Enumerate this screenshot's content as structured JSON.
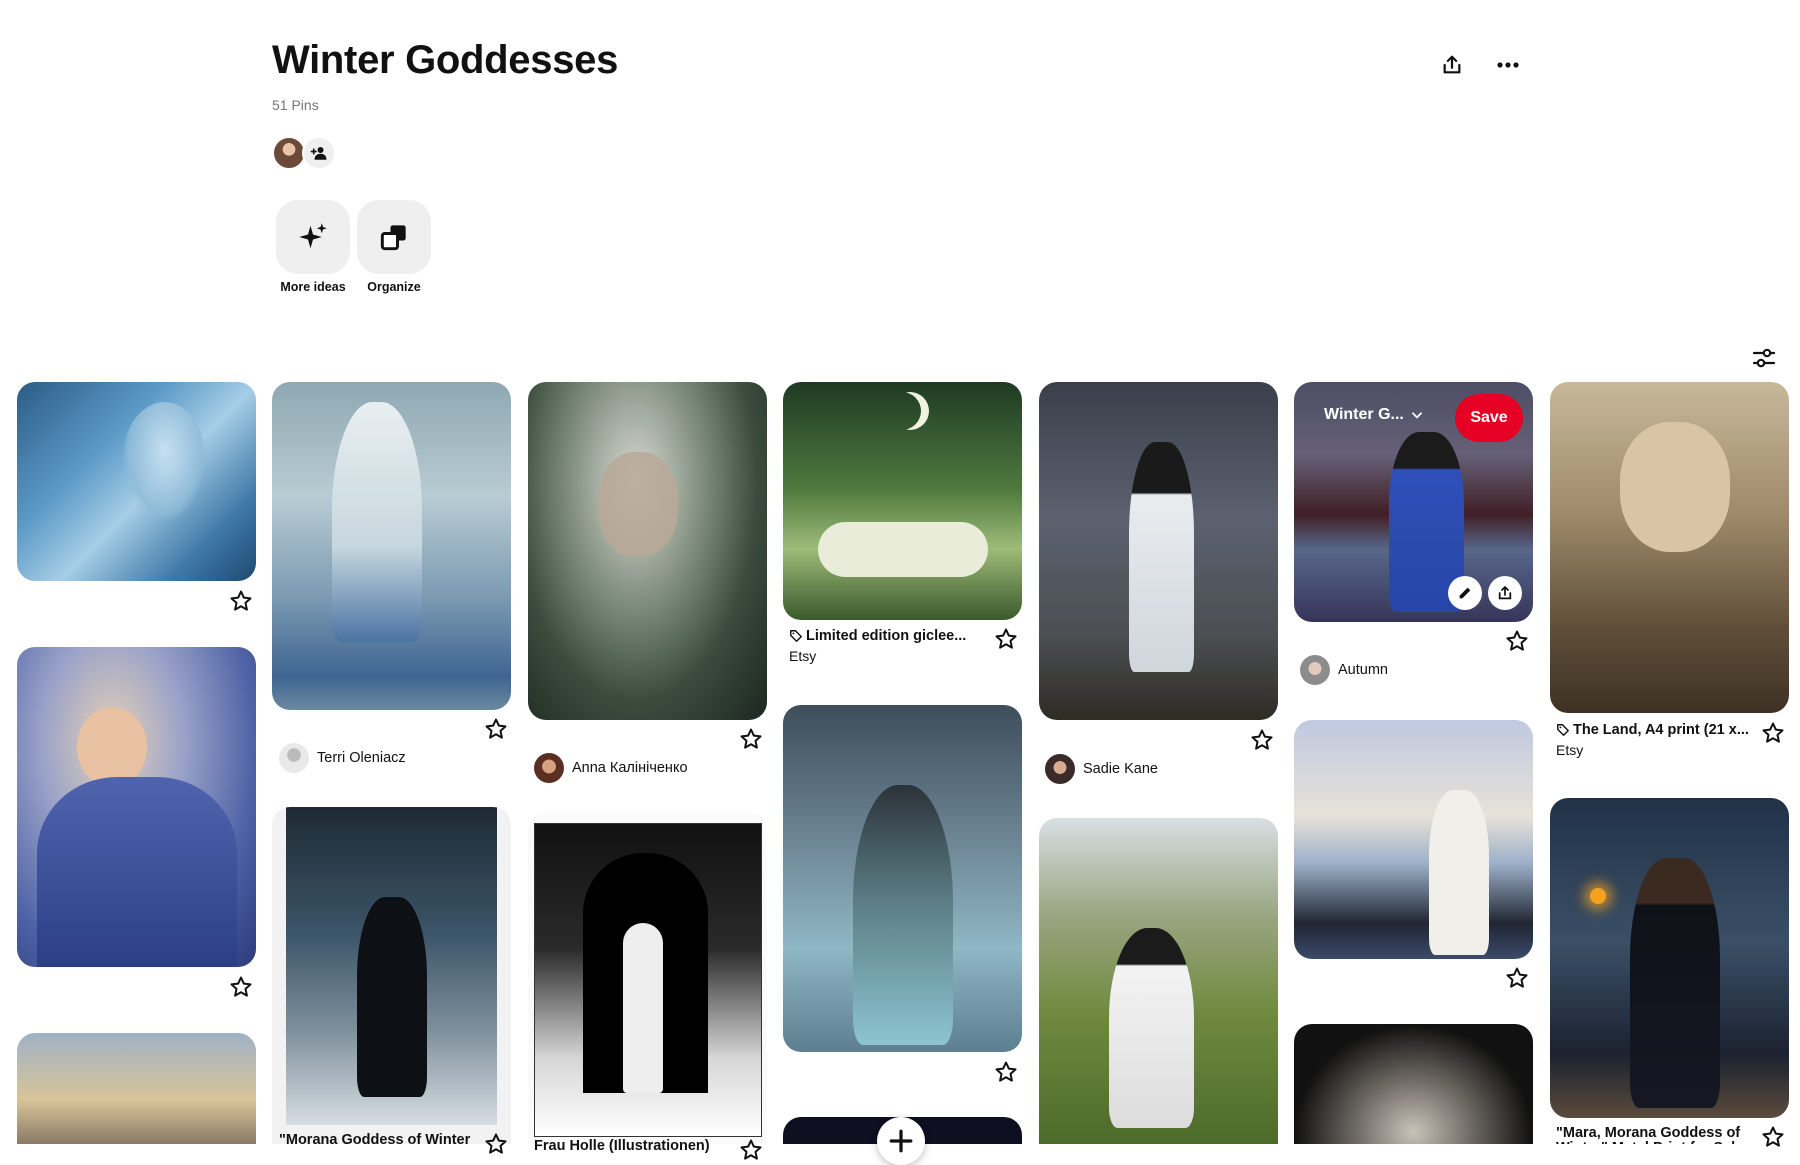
{
  "board": {
    "title": "Winter Goddesses",
    "pin_count": "51 Pins"
  },
  "header_icons": [
    "share-icon",
    "more-icon"
  ],
  "tools": [
    {
      "label": "More ideas",
      "icon": "sparkle-icon"
    },
    {
      "label": "Organize",
      "icon": "organize-icon"
    }
  ],
  "hover_card": {
    "board_name": "Winter G...",
    "save_label": "Save"
  },
  "pins": [
    {
      "caption": "Limited edition giclee...",
      "source": "Etsy"
    },
    {
      "caption": "The Land, A4 print (21 x...",
      "source": "Etsy"
    },
    {
      "caption": "\"Morana Goddess of Winter"
    },
    {
      "caption": "Frau Holle (Illustrationen)"
    },
    {
      "caption": "\"Mara, Morana Goddess of Winter\" Metal Print for Sal..."
    }
  ],
  "pinners": [
    {
      "name": "Terri Oleniacz"
    },
    {
      "name": "Anna Калініченко"
    },
    {
      "name": "Sadie Kane"
    },
    {
      "name": "Autumn"
    }
  ],
  "colors": {
    "save_red": "#e60023",
    "tool_bg": "#efefef",
    "muted_text": "#767676"
  }
}
